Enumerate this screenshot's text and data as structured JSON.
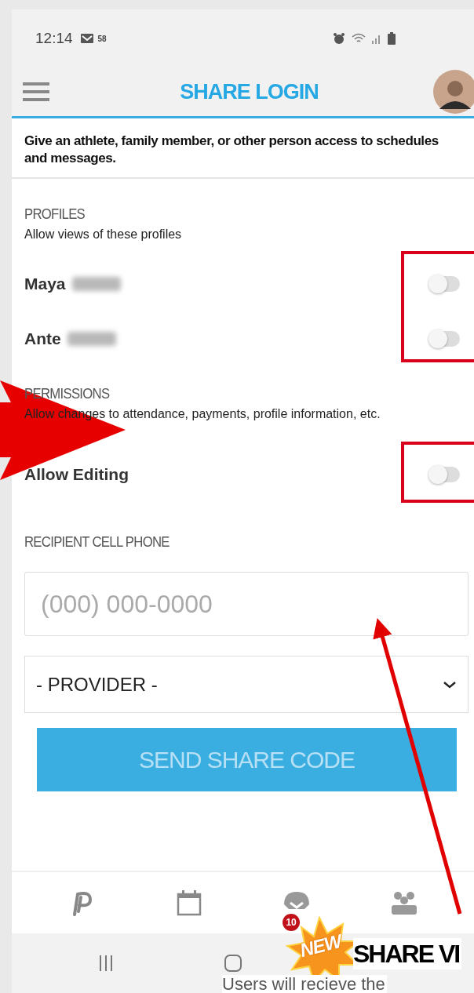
{
  "status_bar": {
    "time": "12:14",
    "notification_count": "58"
  },
  "app_bar": {
    "title": "SHARE LOGIN"
  },
  "intro": "Give an athlete, family member, or other person access to schedules and messages.",
  "profiles": {
    "heading": "PROFILES",
    "subtitle": "Allow views of these profiles",
    "items": [
      {
        "name": "Maya",
        "on": false
      },
      {
        "name": "Ante",
        "on": false
      }
    ]
  },
  "permissions": {
    "heading": "PERMISSIONS",
    "subtitle": "Allow changes to attendance, payments, profile information, etc.",
    "items": [
      {
        "name": "Allow Editing",
        "on": false
      }
    ]
  },
  "recipient": {
    "label": "RECIPIENT CELL PHONE",
    "placeholder": "(000) 000-0000"
  },
  "provider": {
    "value": "- PROVIDER -"
  },
  "send_button": {
    "label": "SEND SHARE CODE",
    "disabled": true
  },
  "bottom_nav": {
    "items": [
      {
        "kind": "logo"
      },
      {
        "kind": "calendar"
      },
      {
        "kind": "chat",
        "badge": "10"
      },
      {
        "kind": "team"
      }
    ]
  },
  "annotation": {
    "badge": "NEW",
    "headline": "SHARE VI",
    "caption": "Users will recieve the"
  }
}
